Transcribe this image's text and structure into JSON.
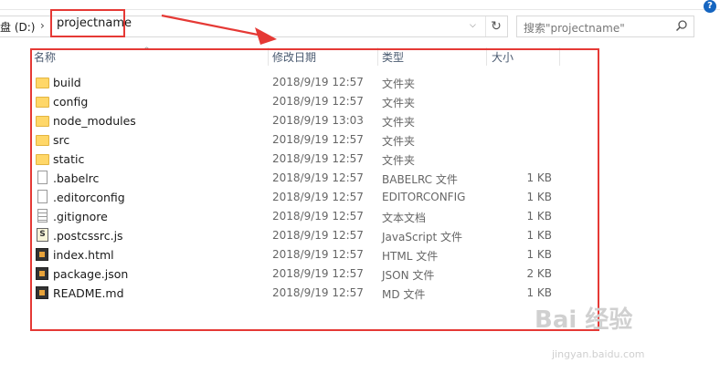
{
  "address": {
    "drive": "盘 (D:)",
    "separator": "›",
    "current": "projectname",
    "dropdown": "⌵",
    "refresh": "↻"
  },
  "search": {
    "placeholder": "搜索\"projectname\""
  },
  "help_label": "?",
  "columns": {
    "name": "名称",
    "date": "修改日期",
    "type": "类型",
    "size": "大小"
  },
  "files": [
    {
      "name": "build",
      "date": "2018/9/19 12:57",
      "type": "文件夹",
      "size": "",
      "icon": "folder-icon"
    },
    {
      "name": "config",
      "date": "2018/9/19 12:57",
      "type": "文件夹",
      "size": "",
      "icon": "folder-icon"
    },
    {
      "name": "node_modules",
      "date": "2018/9/19 13:03",
      "type": "文件夹",
      "size": "",
      "icon": "folder-icon"
    },
    {
      "name": "src",
      "date": "2018/9/19 12:57",
      "type": "文件夹",
      "size": "",
      "icon": "folder-icon"
    },
    {
      "name": "static",
      "date": "2018/9/19 12:57",
      "type": "文件夹",
      "size": "",
      "icon": "folder-icon"
    },
    {
      "name": ".babelrc",
      "date": "2018/9/19 12:57",
      "type": "BABELRC 文件",
      "size": "1 KB",
      "icon": "file-icon"
    },
    {
      "name": ".editorconfig",
      "date": "2018/9/19 12:57",
      "type": "EDITORCONFIG",
      "size": "1 KB",
      "icon": "file-icon"
    },
    {
      "name": ".gitignore",
      "date": "2018/9/19 12:57",
      "type": "文本文档",
      "size": "1 KB",
      "icon": "text-file-icon"
    },
    {
      "name": ".postcssrc.js",
      "date": "2018/9/19 12:57",
      "type": "JavaScript 文件",
      "size": "1 KB",
      "icon": "js-file-icon"
    },
    {
      "name": "index.html",
      "date": "2018/9/19 12:57",
      "type": "HTML 文件",
      "size": "1 KB",
      "icon": "html-file-icon"
    },
    {
      "name": "package.json",
      "date": "2018/9/19 12:57",
      "type": "JSON 文件",
      "size": "2 KB",
      "icon": "json-file-icon"
    },
    {
      "name": "README.md",
      "date": "2018/9/19 12:57",
      "type": "MD 文件",
      "size": "1 KB",
      "icon": "md-file-icon"
    }
  ],
  "watermark": {
    "logo": "Bai 经验",
    "url": "jingyan.baidu.com"
  },
  "annotation_color": "#e53935"
}
